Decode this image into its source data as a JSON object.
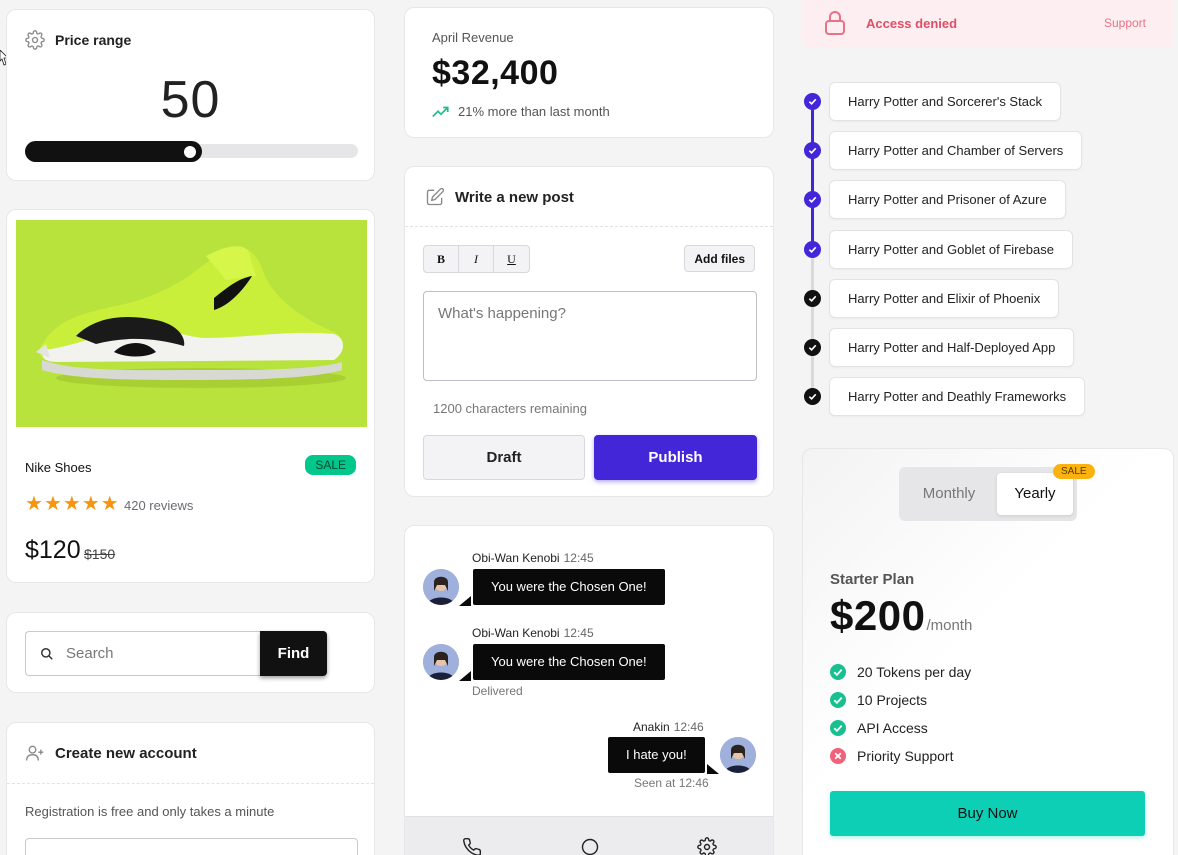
{
  "price_range": {
    "title": "Price range",
    "value": "50",
    "slider_fraction": 0.5
  },
  "product": {
    "name": "Nike Shoes",
    "badge": "SALE",
    "rating": 5,
    "reviews": "420 reviews",
    "price": "$120",
    "old_price": "$150"
  },
  "search": {
    "placeholder": "Search",
    "button": "Find"
  },
  "account": {
    "title": "Create new account",
    "subtitle": "Registration is free and only takes a minute"
  },
  "revenue": {
    "label": "April Revenue",
    "value": "$32,400",
    "trend": "21% more than last month",
    "trend_color": "#18c08f"
  },
  "post": {
    "title": "Write a new post",
    "format_buttons": [
      "B",
      "I",
      "U"
    ],
    "add_files": "Add files",
    "placeholder": "What's happening?",
    "chars_remaining": "1200 characters remaining",
    "draft": "Draft",
    "publish": "Publish",
    "accent": "#4226d8"
  },
  "chat": {
    "messages": [
      {
        "author": "Obi-Wan Kenobi",
        "time": "12:45",
        "text": "You were the Chosen One!"
      },
      {
        "author": "Obi-Wan Kenobi",
        "time": "12:45",
        "text": "You were the Chosen One!",
        "status": "Delivered"
      },
      {
        "author": "Anakin",
        "time": "12:46",
        "text": "I hate you!",
        "status": "Seen at 12:46"
      }
    ],
    "bar_icons": [
      "phone-icon",
      "chat-bubble-icon",
      "gear-icon"
    ]
  },
  "alert": {
    "title": "Access denied",
    "link": "Support",
    "color": "#e04d66"
  },
  "timeline": {
    "items": [
      {
        "label": "Harry Potter and Sorcerer's Stack",
        "state": "done-purple"
      },
      {
        "label": "Harry Potter and Chamber of Servers",
        "state": "done-purple"
      },
      {
        "label": "Harry Potter and Prisoner of Azure",
        "state": "done-purple"
      },
      {
        "label": "Harry Potter and Goblet of Firebase",
        "state": "done-purple"
      },
      {
        "label": "Harry Potter and Elixir of Phoenix",
        "state": "done-black"
      },
      {
        "label": "Harry Potter and Half-Deployed App",
        "state": "done-black"
      },
      {
        "label": "Harry Potter and Deathly Frameworks",
        "state": "done-black"
      }
    ],
    "accent": "#4226d8"
  },
  "pricing": {
    "toggle": {
      "monthly": "Monthly",
      "yearly": "Yearly",
      "selected": "Yearly",
      "badge": "SALE"
    },
    "plan_name": "Starter Plan",
    "price": "$200",
    "period": "/month",
    "features": [
      {
        "label": "20 Tokens per day",
        "included": true
      },
      {
        "label": "10 Projects",
        "included": true
      },
      {
        "label": "API Access",
        "included": true
      },
      {
        "label": "Priority Support",
        "included": false
      }
    ],
    "buy": "Buy Now",
    "accent": "#0ccfb6"
  }
}
